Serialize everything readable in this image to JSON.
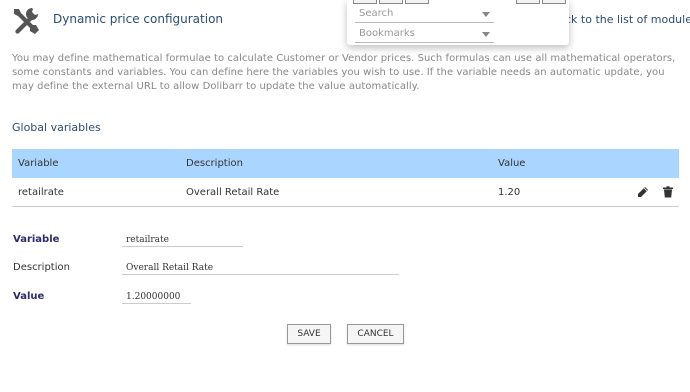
{
  "header": {
    "title": "Dynamic price configuration",
    "back_link": "ck to the list of modules",
    "icon": "tools-icon"
  },
  "dropdown": {
    "search_placeholder": "Search",
    "bookmarks_placeholder": "Bookmarks"
  },
  "intro_text": "You may define mathematical formulae to calculate Customer or Vendor prices. Such formulas can use all mathematical operators, some constants and variables. You can define here the variables you wish to use. If the variable needs an automatic update, you may define the external URL to allow Dolibarr to update the value automatically.",
  "section_title": "Global variables",
  "table": {
    "headers": [
      "Variable",
      "Description",
      "Value"
    ],
    "rows": [
      {
        "variable": "retailrate",
        "description": "Overall Retail Rate",
        "value": "1.20"
      }
    ]
  },
  "form": {
    "variable_label": "Variable",
    "variable_value": "retailrate",
    "description_label": "Description",
    "description_value": "Overall Retail Rate",
    "value_label": "Value",
    "value_value": "1.20000000"
  },
  "buttons": {
    "save": "SAVE",
    "cancel": "CANCEL"
  },
  "colors": {
    "accent": "#2a4d74",
    "table_header_bg": "#a9d5ff"
  }
}
